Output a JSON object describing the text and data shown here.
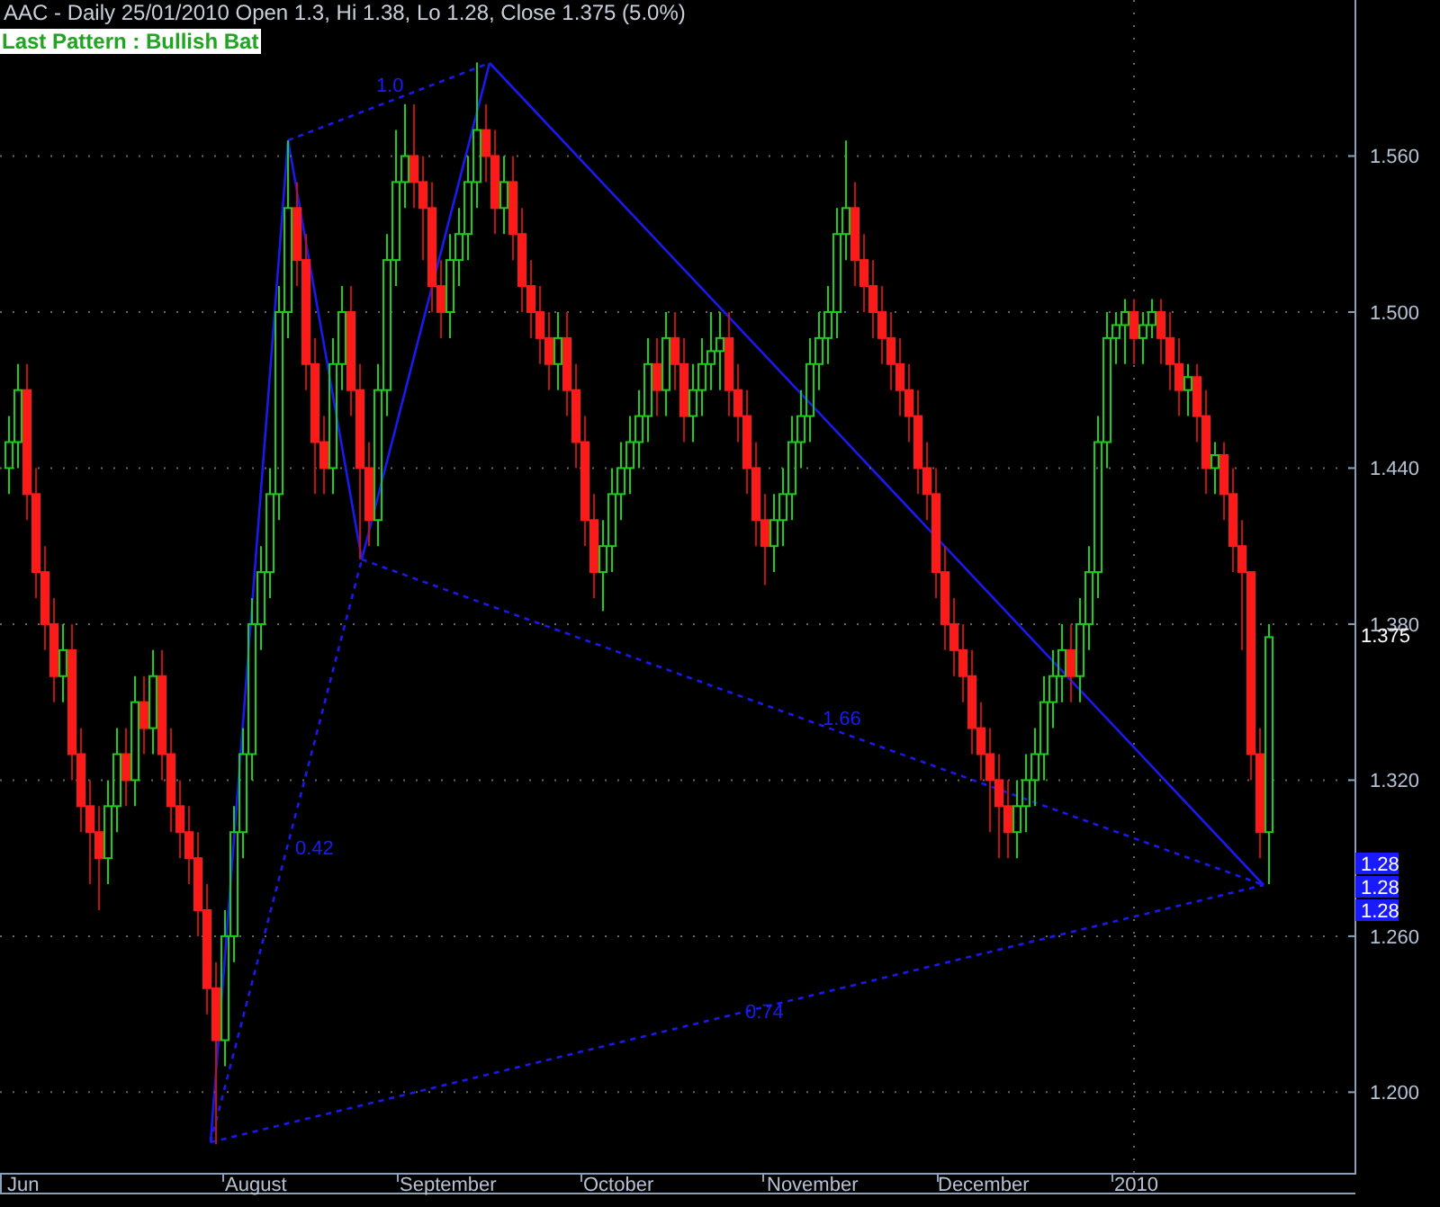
{
  "header": {
    "title": "AAC - Daily 25/01/2010 Open 1.3, Hi 1.38, Lo 1.28, Close 1.375 (5.0%)",
    "pattern_label": "Last Pattern : Bullish Bat"
  },
  "chart": {
    "chart_data": {
      "type": "candlestick",
      "grid": true,
      "ylim": [
        1.169,
        1.62
      ],
      "yticks": [
        {
          "value": 1.56,
          "label": "1.560"
        },
        {
          "value": 1.5,
          "label": "1.500"
        },
        {
          "value": 1.44,
          "label": "1.440"
        },
        {
          "value": 1.38,
          "label": "1.380"
        },
        {
          "value": 1.32,
          "label": "1.320"
        },
        {
          "value": 1.26,
          "label": "1.260"
        },
        {
          "value": 1.2,
          "label": "1.200"
        }
      ],
      "ohlc": [
        [
          1.44,
          1.46,
          1.43,
          1.45
        ],
        [
          1.45,
          1.48,
          1.44,
          1.47
        ],
        [
          1.47,
          1.48,
          1.42,
          1.43
        ],
        [
          1.43,
          1.44,
          1.39,
          1.4
        ],
        [
          1.4,
          1.41,
          1.37,
          1.38
        ],
        [
          1.38,
          1.39,
          1.35,
          1.36
        ],
        [
          1.36,
          1.38,
          1.35,
          1.37
        ],
        [
          1.37,
          1.38,
          1.32,
          1.33
        ],
        [
          1.33,
          1.34,
          1.3,
          1.31
        ],
        [
          1.31,
          1.32,
          1.28,
          1.3
        ],
        [
          1.3,
          1.31,
          1.27,
          1.29
        ],
        [
          1.29,
          1.32,
          1.28,
          1.31
        ],
        [
          1.31,
          1.34,
          1.3,
          1.33
        ],
        [
          1.33,
          1.34,
          1.31,
          1.32
        ],
        [
          1.32,
          1.36,
          1.31,
          1.35
        ],
        [
          1.35,
          1.36,
          1.33,
          1.34
        ],
        [
          1.34,
          1.37,
          1.33,
          1.36
        ],
        [
          1.36,
          1.37,
          1.32,
          1.33
        ],
        [
          1.33,
          1.34,
          1.3,
          1.31
        ],
        [
          1.31,
          1.32,
          1.29,
          1.3
        ],
        [
          1.3,
          1.31,
          1.28,
          1.29
        ],
        [
          1.29,
          1.3,
          1.26,
          1.27
        ],
        [
          1.27,
          1.28,
          1.23,
          1.24
        ],
        [
          1.24,
          1.25,
          1.18,
          1.22
        ],
        [
          1.22,
          1.27,
          1.21,
          1.26
        ],
        [
          1.26,
          1.31,
          1.25,
          1.3
        ],
        [
          1.3,
          1.34,
          1.29,
          1.33
        ],
        [
          1.33,
          1.39,
          1.32,
          1.38
        ],
        [
          1.38,
          1.41,
          1.37,
          1.4
        ],
        [
          1.4,
          1.44,
          1.39,
          1.43
        ],
        [
          1.43,
          1.51,
          1.42,
          1.5
        ],
        [
          1.5,
          1.566,
          1.49,
          1.54
        ],
        [
          1.54,
          1.55,
          1.51,
          1.52
        ],
        [
          1.52,
          1.53,
          1.47,
          1.48
        ],
        [
          1.48,
          1.49,
          1.43,
          1.45
        ],
        [
          1.45,
          1.46,
          1.43,
          1.44
        ],
        [
          1.44,
          1.49,
          1.43,
          1.48
        ],
        [
          1.48,
          1.51,
          1.47,
          1.5
        ],
        [
          1.5,
          1.51,
          1.46,
          1.47
        ],
        [
          1.47,
          1.48,
          1.405,
          1.44
        ],
        [
          1.44,
          1.45,
          1.41,
          1.42
        ],
        [
          1.42,
          1.48,
          1.41,
          1.47
        ],
        [
          1.47,
          1.53,
          1.46,
          1.52
        ],
        [
          1.52,
          1.57,
          1.51,
          1.55
        ],
        [
          1.55,
          1.58,
          1.54,
          1.56
        ],
        [
          1.56,
          1.58,
          1.54,
          1.55
        ],
        [
          1.55,
          1.56,
          1.52,
          1.54
        ],
        [
          1.54,
          1.55,
          1.5,
          1.51
        ],
        [
          1.51,
          1.52,
          1.49,
          1.5
        ],
        [
          1.5,
          1.53,
          1.49,
          1.52
        ],
        [
          1.52,
          1.54,
          1.51,
          1.53
        ],
        [
          1.53,
          1.56,
          1.52,
          1.55
        ],
        [
          1.55,
          1.596,
          1.54,
          1.57
        ],
        [
          1.57,
          1.58,
          1.55,
          1.56
        ],
        [
          1.56,
          1.57,
          1.53,
          1.54
        ],
        [
          1.54,
          1.56,
          1.53,
          1.55
        ],
        [
          1.55,
          1.56,
          1.52,
          1.53
        ],
        [
          1.53,
          1.54,
          1.5,
          1.51
        ],
        [
          1.51,
          1.52,
          1.49,
          1.5
        ],
        [
          1.5,
          1.51,
          1.48,
          1.49
        ],
        [
          1.49,
          1.5,
          1.47,
          1.48
        ],
        [
          1.48,
          1.5,
          1.47,
          1.49
        ],
        [
          1.49,
          1.5,
          1.46,
          1.47
        ],
        [
          1.47,
          1.48,
          1.44,
          1.45
        ],
        [
          1.45,
          1.46,
          1.41,
          1.42
        ],
        [
          1.42,
          1.43,
          1.39,
          1.4
        ],
        [
          1.4,
          1.42,
          1.385,
          1.41
        ],
        [
          1.41,
          1.44,
          1.4,
          1.43
        ],
        [
          1.43,
          1.45,
          1.42,
          1.44
        ],
        [
          1.44,
          1.46,
          1.43,
          1.45
        ],
        [
          1.45,
          1.47,
          1.44,
          1.46
        ],
        [
          1.46,
          1.49,
          1.45,
          1.48
        ],
        [
          1.48,
          1.49,
          1.46,
          1.47
        ],
        [
          1.47,
          1.5,
          1.46,
          1.49
        ],
        [
          1.49,
          1.5,
          1.47,
          1.48
        ],
        [
          1.48,
          1.49,
          1.45,
          1.46
        ],
        [
          1.46,
          1.48,
          1.45,
          1.47
        ],
        [
          1.47,
          1.49,
          1.46,
          1.48
        ],
        [
          1.48,
          1.5,
          1.47,
          1.485
        ],
        [
          1.485,
          1.5,
          1.47,
          1.49
        ],
        [
          1.49,
          1.5,
          1.46,
          1.47
        ],
        [
          1.47,
          1.48,
          1.45,
          1.46
        ],
        [
          1.46,
          1.47,
          1.43,
          1.44
        ],
        [
          1.44,
          1.45,
          1.41,
          1.42
        ],
        [
          1.42,
          1.43,
          1.395,
          1.41
        ],
        [
          1.41,
          1.43,
          1.4,
          1.42
        ],
        [
          1.42,
          1.44,
          1.41,
          1.43
        ],
        [
          1.43,
          1.46,
          1.42,
          1.45
        ],
        [
          1.45,
          1.47,
          1.44,
          1.46
        ],
        [
          1.46,
          1.49,
          1.45,
          1.48
        ],
        [
          1.48,
          1.5,
          1.47,
          1.49
        ],
        [
          1.49,
          1.51,
          1.48,
          1.5
        ],
        [
          1.5,
          1.54,
          1.49,
          1.53
        ],
        [
          1.53,
          1.566,
          1.52,
          1.54
        ],
        [
          1.54,
          1.55,
          1.51,
          1.52
        ],
        [
          1.52,
          1.53,
          1.5,
          1.51
        ],
        [
          1.51,
          1.52,
          1.49,
          1.5
        ],
        [
          1.5,
          1.51,
          1.48,
          1.49
        ],
        [
          1.49,
          1.5,
          1.47,
          1.48
        ],
        [
          1.48,
          1.49,
          1.46,
          1.47
        ],
        [
          1.47,
          1.48,
          1.45,
          1.46
        ],
        [
          1.46,
          1.47,
          1.43,
          1.44
        ],
        [
          1.44,
          1.45,
          1.42,
          1.43
        ],
        [
          1.43,
          1.44,
          1.39,
          1.4
        ],
        [
          1.4,
          1.41,
          1.37,
          1.38
        ],
        [
          1.38,
          1.39,
          1.36,
          1.37
        ],
        [
          1.37,
          1.38,
          1.35,
          1.36
        ],
        [
          1.36,
          1.37,
          1.33,
          1.34
        ],
        [
          1.34,
          1.35,
          1.32,
          1.33
        ],
        [
          1.33,
          1.34,
          1.3,
          1.32
        ],
        [
          1.32,
          1.33,
          1.29,
          1.31
        ],
        [
          1.31,
          1.32,
          1.29,
          1.3
        ],
        [
          1.3,
          1.32,
          1.29,
          1.31
        ],
        [
          1.31,
          1.33,
          1.3,
          1.32
        ],
        [
          1.32,
          1.34,
          1.31,
          1.33
        ],
        [
          1.33,
          1.36,
          1.32,
          1.35
        ],
        [
          1.35,
          1.37,
          1.34,
          1.36
        ],
        [
          1.36,
          1.38,
          1.35,
          1.37
        ],
        [
          1.37,
          1.38,
          1.35,
          1.36
        ],
        [
          1.36,
          1.39,
          1.35,
          1.38
        ],
        [
          1.38,
          1.41,
          1.37,
          1.4
        ],
        [
          1.4,
          1.46,
          1.39,
          1.45
        ],
        [
          1.45,
          1.5,
          1.44,
          1.49
        ],
        [
          1.49,
          1.5,
          1.48,
          1.495
        ],
        [
          1.495,
          1.505,
          1.48,
          1.5
        ],
        [
          1.5,
          1.505,
          1.48,
          1.49
        ],
        [
          1.49,
          1.5,
          1.48,
          1.495
        ],
        [
          1.495,
          1.505,
          1.49,
          1.5
        ],
        [
          1.5,
          1.505,
          1.48,
          1.49
        ],
        [
          1.49,
          1.5,
          1.47,
          1.48
        ],
        [
          1.48,
          1.49,
          1.46,
          1.47
        ],
        [
          1.47,
          1.48,
          1.46,
          1.475
        ],
        [
          1.475,
          1.48,
          1.45,
          1.46
        ],
        [
          1.46,
          1.47,
          1.43,
          1.44
        ],
        [
          1.44,
          1.45,
          1.43,
          1.445
        ],
        [
          1.445,
          1.45,
          1.42,
          1.43
        ],
        [
          1.43,
          1.44,
          1.4,
          1.41
        ],
        [
          1.41,
          1.42,
          1.37,
          1.4
        ],
        [
          1.4,
          1.4,
          1.32,
          1.33
        ],
        [
          1.33,
          1.34,
          1.29,
          1.3
        ],
        [
          1.3,
          1.38,
          1.28,
          1.375
        ]
      ]
    },
    "x_labels": [
      "Jun",
      "August",
      "September",
      "October",
      "November",
      "December",
      "2010"
    ],
    "last_price": "1.375",
    "price_markers": [
      "1.28",
      "1.28",
      "1.28"
    ],
    "pattern_ratios": [
      {
        "text": "1.0"
      },
      {
        "text": "0.42"
      },
      {
        "text": "1.66"
      },
      {
        "text": "0.74"
      }
    ]
  }
}
